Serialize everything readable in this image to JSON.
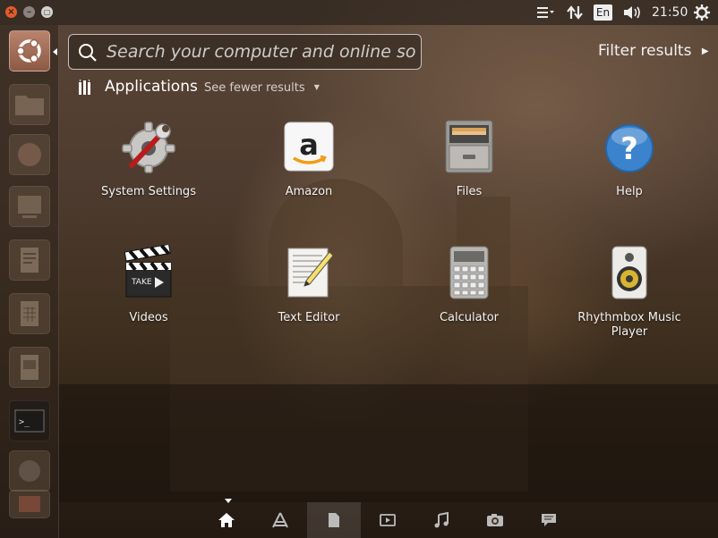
{
  "top_panel": {
    "window_buttons": [
      "close-icon",
      "minimize-icon",
      "maximize-icon"
    ],
    "keyboard_layout": "En",
    "clock": "21:50",
    "icons": [
      "menu-icon",
      "network-icon",
      "volume-icon",
      "gear-icon"
    ]
  },
  "launcher": {
    "items": [
      "dash-home",
      "files",
      "browser",
      "workspace",
      "writer",
      "calc",
      "impress",
      "terminal",
      "system",
      "software-center"
    ]
  },
  "search": {
    "placeholder": "Search your computer and online sources"
  },
  "filter": {
    "label": "Filter results"
  },
  "section": {
    "title": "Applications",
    "toggle": "See fewer results"
  },
  "apps": [
    {
      "label": "System Settings",
      "icon": "settings-icon"
    },
    {
      "label": "Amazon",
      "icon": "amazon-icon"
    },
    {
      "label": "Files",
      "icon": "files-icon"
    },
    {
      "label": "Help",
      "icon": "help-icon"
    },
    {
      "label": "Videos",
      "icon": "videos-icon"
    },
    {
      "label": "Text Editor",
      "icon": "text-editor-icon"
    },
    {
      "label": "Calculator",
      "icon": "calculator-icon"
    },
    {
      "label": "Rhythmbox Music Player",
      "icon": "rhythmbox-icon"
    }
  ],
  "lenses": [
    "home-icon",
    "applications-icon",
    "files-icon",
    "video-icon",
    "music-icon",
    "photo-icon",
    "social-icon"
  ],
  "colors": {
    "accent": "#dd4814",
    "panel": "#1e1916"
  }
}
